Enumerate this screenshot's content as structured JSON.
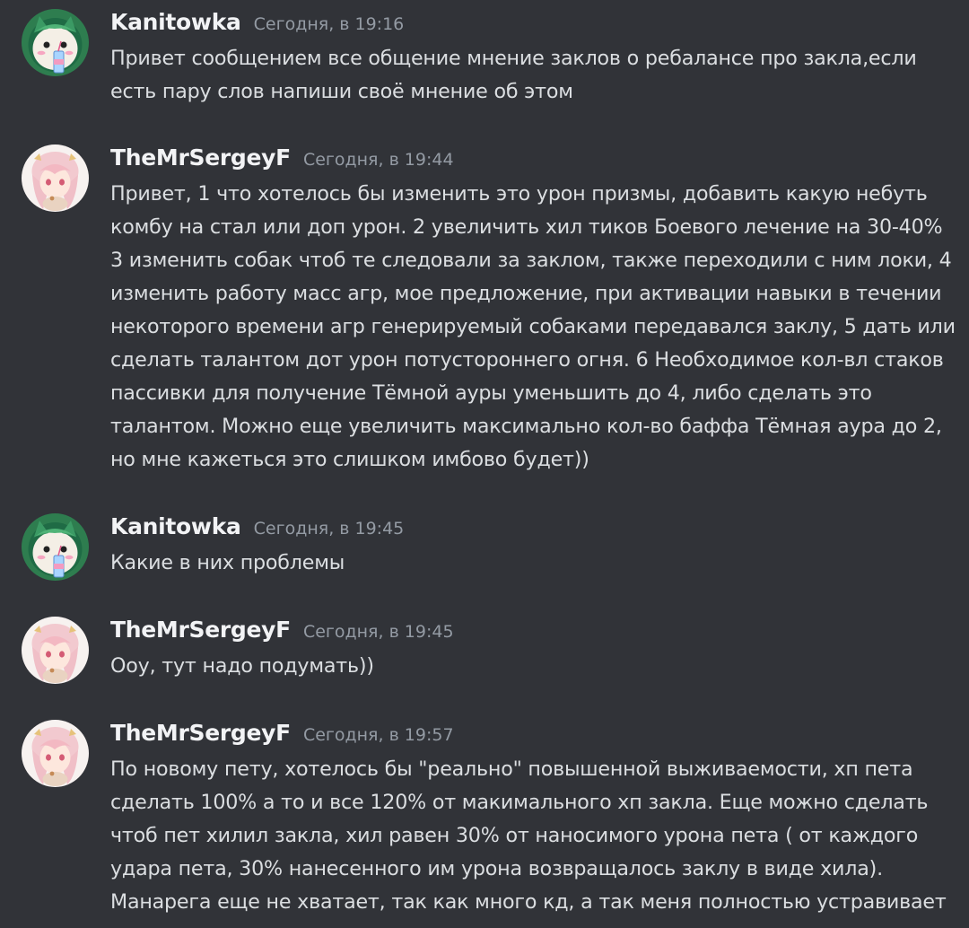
{
  "messages": [
    {
      "author": "Kanitowka",
      "avatar": "cat-avatar",
      "time": "Сегодня, в 19:16",
      "lines": [
        "Привет сообщением все общение мнение заклов о ребалансе про закла,если",
        "есть пару слов напиши своё мнение об этом"
      ]
    },
    {
      "author": "TheMrSergeyF",
      "avatar": "anime-girl-avatar",
      "time": "Сегодня, в 19:44",
      "lines": [
        "Привет, 1 что хотелось бы изменить это урон призмы, добавить какую небуть",
        "комбу на стал или доп урон. 2 увеличить хил тиков Боевого лечение на 30-40%",
        "3 изменить собак чтоб те следовали за заклом, также переходили с ним локи, 4",
        "изменить работу масс агр, мое предложение, при активации навыки в течении",
        "некоторого времени агр генерируемый собаками передавался заклу, 5 дать или",
        "сделать талантом дот урон потустороннего огня. 6 Необходимое кол-вл стаков",
        "пассивки для получение Тёмной ауры уменьшить до 4, либо сделать это",
        "талантом. Можно еще увеличить максимально кол-во баффа Тёмная аура до 2,",
        "но мне кажеться это слишком имбово будет))"
      ]
    },
    {
      "author": "Kanitowka",
      "avatar": "cat-avatar",
      "time": "Сегодня, в 19:45",
      "lines": [
        "Какие в них проблемы"
      ]
    },
    {
      "author": "TheMrSergeyF",
      "avatar": "anime-girl-avatar",
      "time": "Сегодня, в 19:45",
      "lines": [
        "Ооу, тут надо подумать))"
      ]
    },
    {
      "author": "TheMrSergeyF",
      "avatar": "anime-girl-avatar",
      "time": "Сегодня, в 19:57",
      "lines": [
        "По новому пету, хотелось бы \"реально\" повышенной выживаемости, хп пета",
        "сделать 100% а то и все 120% от макимального хп закла. Еще можно сделать",
        "чтоб пет хилил закла, хил равен 30% от наносимого урона пета ( от каждого",
        "удара пета, 30% нанесенного им урона возвращалось заклу в виде хила).",
        "Манарега еще не хватает, так как много кд, а так меня полностью устравивает"
      ]
    }
  ],
  "colors": {
    "background": "#313338",
    "username": "#f2f3f5",
    "timestamp": "#949ba4",
    "text": "#dbdee1"
  }
}
